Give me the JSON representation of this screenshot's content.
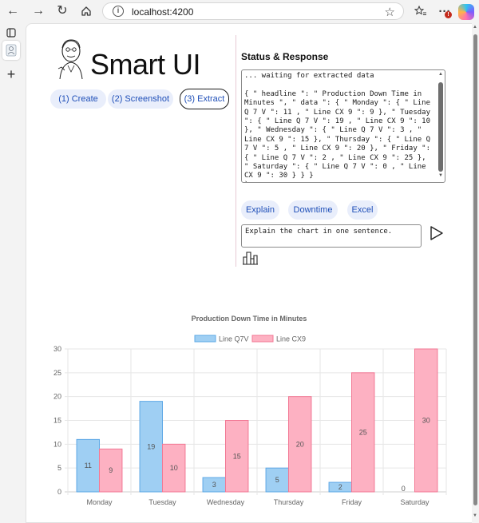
{
  "browser": {
    "url": "localhost:4200",
    "icons": [
      "back-icon",
      "forward-icon",
      "refresh-icon",
      "home-icon",
      "info-icon",
      "favorite-star-icon",
      "favorites-icon",
      "more-icon",
      "copilot-icon"
    ],
    "notification_badge": "!"
  },
  "app": {
    "title": "Smart UI",
    "steps": [
      {
        "label": "(1) Create"
      },
      {
        "label": "(2) Screenshot"
      },
      {
        "label": "(3) Extract",
        "active": true
      }
    ],
    "status": {
      "heading": "Status & Response",
      "log": "... waiting for extracted data\n\n{ \" headline \": \" Production Down Time in Minutes \", \" data \": { \" Monday \": { \" Line Q 7 V \": 11 , \" Line CX 9 \": 9 }, \" Tuesday \": { \" Line Q 7 V \": 19 , \" Line CX 9 \": 10 }, \" Wednesday \": { \" Line Q 7 V \": 3 , \" Line CX 9 \": 15 }, \" Thursday \": { \" Line Q 7 V \": 5 , \" Line CX 9 \": 20 }, \" Friday \": { \" Line Q 7 V \": 2 , \" Line CX 9 \": 25 }, \" Saturday \": { \" Line Q 7 V \": 0 , \" Line CX 9 \": 30 } } }\n`\n... extracted data received"
    },
    "actions": [
      {
        "label": "Explain"
      },
      {
        "label": "Downtime"
      },
      {
        "label": "Excel"
      }
    ],
    "prompt": {
      "value": "Explain the chart in one sentence."
    }
  },
  "chart_data": {
    "type": "bar",
    "title": "Production Down Time in Minutes",
    "categories": [
      "Monday",
      "Tuesday",
      "Wednesday",
      "Thursday",
      "Friday",
      "Saturday"
    ],
    "series": [
      {
        "name": "Line Q7V",
        "values": [
          11,
          19,
          3,
          5,
          2,
          0
        ],
        "color": "#9fcff3",
        "border": "#5ea8e6"
      },
      {
        "name": "Line CX9",
        "values": [
          9,
          10,
          15,
          20,
          25,
          30
        ],
        "color": "#fdb1c2",
        "border": "#f27894"
      }
    ],
    "ylim": [
      0,
      30
    ],
    "yticks": [
      0,
      5,
      10,
      15,
      20,
      25,
      30
    ],
    "legend": "top",
    "grid": true,
    "data_labels": true
  }
}
